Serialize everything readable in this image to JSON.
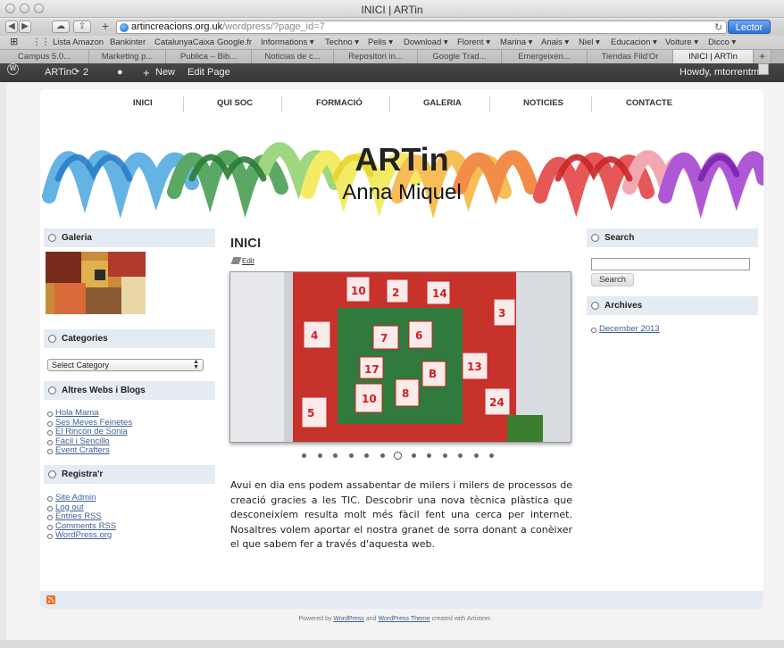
{
  "window": {
    "title": "INICI | ARTin"
  },
  "toolbar": {
    "url_host": "artincreacions.org.uk",
    "url_path": "/wordpress/?page_id=7",
    "reader_label": "Lector"
  },
  "bookmarks": [
    "Lista Amazon",
    "Bankinter",
    "CatalunyaCaixa",
    "Google.fr",
    "Informations ▾",
    "Techno ▾",
    "Pelis ▾",
    "Download ▾",
    "Florent ▾",
    "Marina ▾",
    "Anais ▾",
    "Niel ▾",
    "Educacion ▾",
    "Voiture ▾",
    "Dicco ▾"
  ],
  "tabs": [
    "Campus 5.0...",
    "Marketing p...",
    "Publica – Bib...",
    "Noticias de c...",
    "Repositori in...",
    "Google Trad...",
    "Emergeixen...",
    "Tiendas Fild'Or",
    "INICI | ARTin"
  ],
  "adminbar": {
    "site": "ARTin",
    "updates": "2",
    "new": "New",
    "edit": "Edit Page",
    "howdy": "Howdy, mtorrentmi"
  },
  "menu": [
    "INICI",
    "QUI SOC",
    "FORMACIÓ",
    "GALERIA",
    "NOTICIES",
    "CONTACTE"
  ],
  "header": {
    "title": "ARTin",
    "subtitle": "Anna Miquel"
  },
  "sidebar_left": {
    "galeria": "Galeria",
    "categories": "Categories",
    "select_category": "Select Category",
    "blogs_title": "Altres Webs i Blogs",
    "blogs": [
      "Hola Mama",
      "Ses Meves Feinetes",
      "El Rincón de Sonia",
      "Fàcil i Sencillo",
      "Event Crafters"
    ],
    "register_title": "Registra'r",
    "register": [
      "Site Admin",
      "Log out",
      "Entries RSS",
      "Comments RSS",
      "WordPress.org"
    ]
  },
  "post": {
    "title": "INICI",
    "edit": "Edit",
    "body": "Avui en dia ens podem assabentar de milers i milers de processos de creació gracies a les TIC. Descobrir una nova tècnica plàstica que desconeixíem resulta molt més fàcil fent una cerca per internet. Nosaltres volem aportar el nostra granet de sorra donant a conèixer el que sabem fer a través d'aquesta web.",
    "slide_count": 13,
    "active_slide": 6
  },
  "sidebar_right": {
    "search_title": "Search",
    "search_button": "Search",
    "archives_title": "Archives",
    "archives": [
      "December 2013"
    ]
  },
  "footer": {
    "powered": "Powered by",
    "wordpress": "WordPress",
    "and": "and",
    "theme": "WordPress Theme",
    "created": "created with Artisteer."
  }
}
